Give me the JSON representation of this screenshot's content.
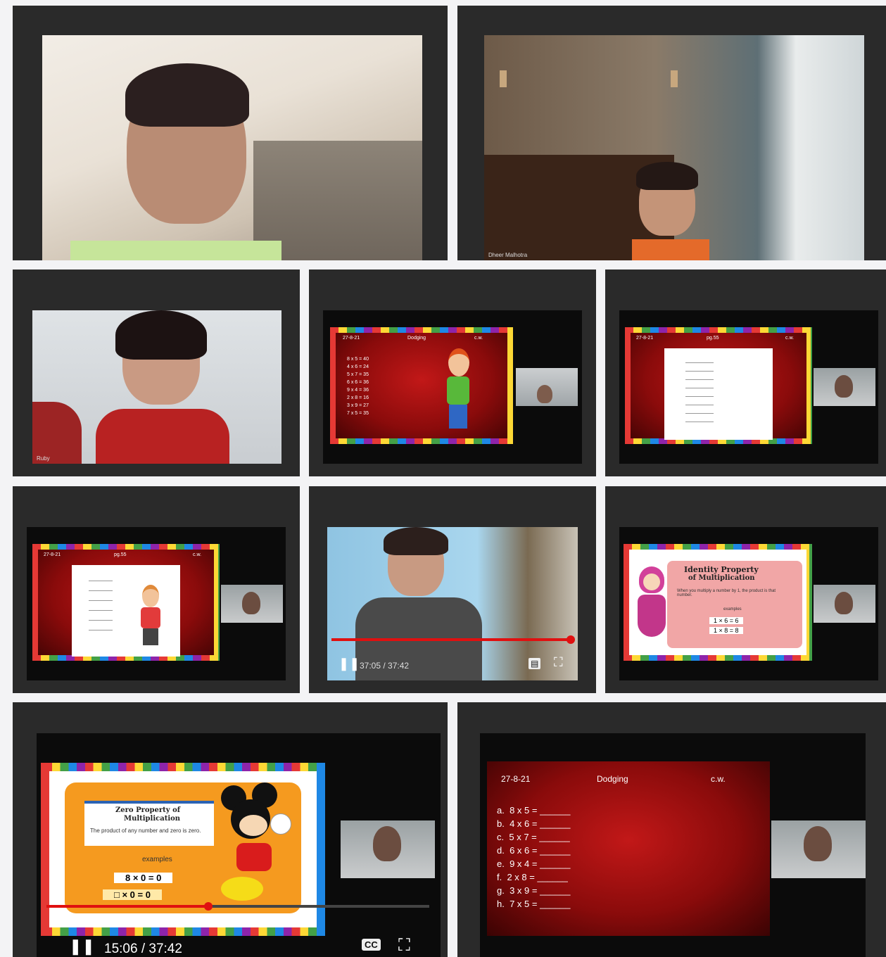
{
  "tiles": {
    "t3": {
      "name": "Ruby"
    },
    "t2": {
      "name": "Dheer Malhotra"
    }
  },
  "slides": {
    "dodging": {
      "date": "27-8-21",
      "title": "Dodging",
      "cw": "c.w.",
      "rows": [
        {
          "letter": "a.",
          "expr": "8 x 5 ="
        },
        {
          "letter": "b.",
          "expr": "4 x 6 ="
        },
        {
          "letter": "c.",
          "expr": "5 x 7 ="
        },
        {
          "letter": "d.",
          "expr": "6 x 6 ="
        },
        {
          "letter": "e.",
          "expr": "9 x 4 ="
        },
        {
          "letter": "f.",
          "expr": "2 x 8 ="
        },
        {
          "letter": "g.",
          "expr": "3 x 9 ="
        },
        {
          "letter": "h.",
          "expr": "7 x 5 ="
        }
      ],
      "small_values": [
        "40",
        "24",
        "35",
        "36",
        "36",
        "16",
        "27",
        "35"
      ]
    },
    "pg": {
      "date": "27-8-21",
      "title": "pg.55",
      "cw": "c.w."
    },
    "identity": {
      "title_line1": "Identity Property",
      "title_line2": "of Multiplication",
      "body": "When you multiply a number by 1, the product is that number.",
      "examples_label": "examples",
      "ex1": "1 × 6 = 6",
      "ex2": "1 × 8 = 8"
    },
    "zero": {
      "title_line1": "Zero Property of",
      "title_line2": "Multiplication",
      "body": "The product of any number and zero is zero.",
      "examples_label": "examples",
      "ex1": "8 × 0 = 0",
      "ex2": "□ × 0 = 0"
    }
  },
  "players": {
    "p1": {
      "time": "37:05 / 37:42",
      "progress": 0.98
    },
    "p2": {
      "time": "15:06 / 37:42",
      "progress": 0.4
    }
  },
  "icons": {
    "pause": "pause-icon",
    "cc": "cc-icon",
    "fullscreen": "fullscreen-icon"
  }
}
